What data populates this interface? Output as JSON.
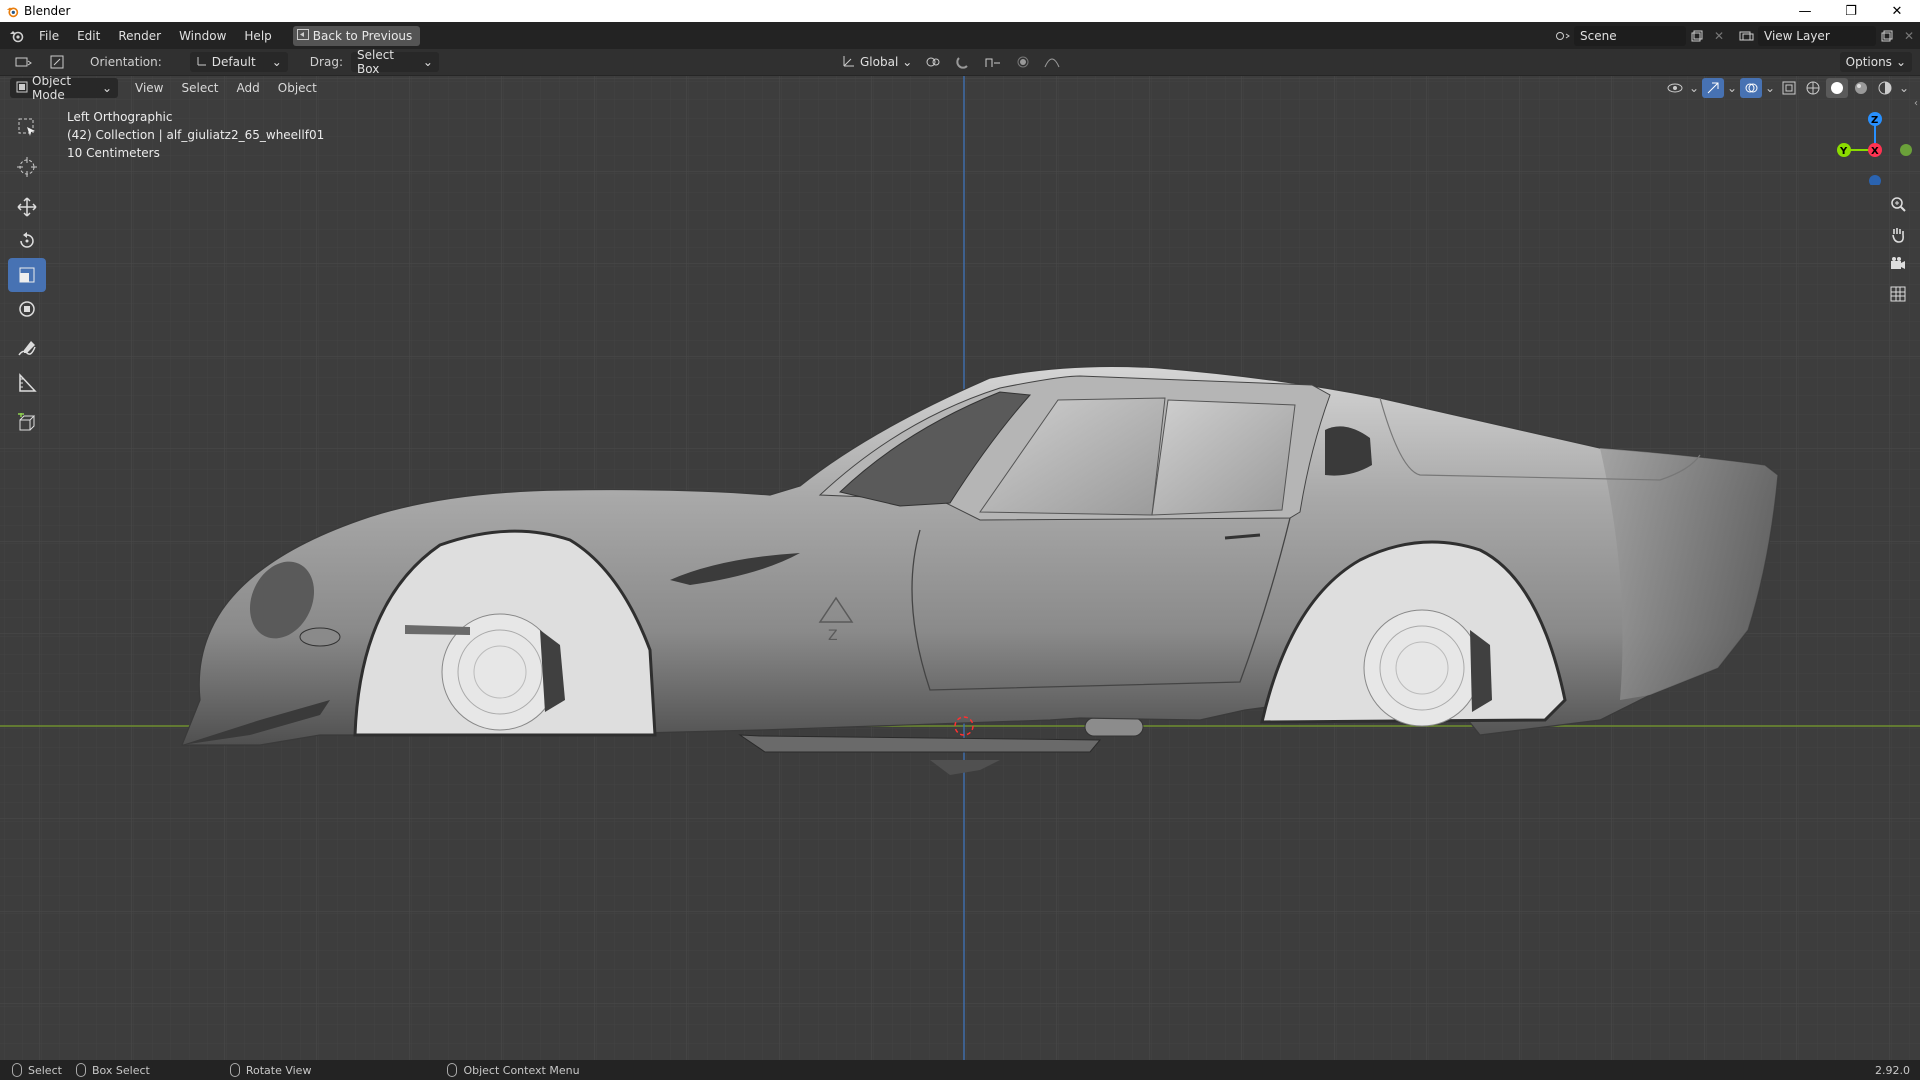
{
  "window": {
    "title": "Blender",
    "controls": [
      "minimize",
      "restore",
      "close"
    ]
  },
  "topbar": {
    "menus": [
      "File",
      "Edit",
      "Render",
      "Window",
      "Help"
    ],
    "back_button": "Back to Previous",
    "scene_name": "Scene",
    "view_layer": "View Layer"
  },
  "tool_header": {
    "orientation_label": "Orientation:",
    "orientation_value": "Default",
    "drag_label": "Drag:",
    "drag_value": "Select Box",
    "transform_orientation": "Global",
    "options_label": "Options"
  },
  "viewport_header": {
    "mode": "Object Mode",
    "menus": [
      "View",
      "Select",
      "Add",
      "Object"
    ]
  },
  "viewport_info": {
    "view_name": "Left Orthographic",
    "collection": "(42) Collection | alf_giuliatz2_65_wheellf01",
    "grid_scale": "10 Centimeters"
  },
  "toolbar": {
    "tools": [
      "select-box",
      "cursor",
      "move",
      "rotate",
      "scale",
      "transform",
      "annotate",
      "measure",
      "add-cube"
    ],
    "active_tool": "scale"
  },
  "navigation_gizmo": {
    "axes": [
      "Z",
      "Y",
      "X"
    ],
    "buttons": [
      "zoom",
      "pan",
      "camera",
      "orthographic"
    ]
  },
  "statusbar": {
    "items": [
      "Select",
      "Box Select",
      "Rotate View",
      "Object Context Menu"
    ],
    "version": "2.92.0"
  },
  "colors": {
    "accent": "#4772b3",
    "axis_x": "#ff3352",
    "axis_y": "#8bdc00",
    "axis_z": "#2890ff"
  }
}
